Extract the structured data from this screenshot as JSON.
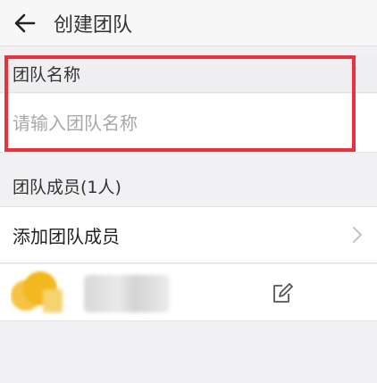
{
  "header": {
    "title": "创建团队",
    "back_icon": "arrow-left-icon"
  },
  "team_name": {
    "label": "团队名称",
    "placeholder": "请输入团队名称",
    "value": ""
  },
  "members": {
    "label": "团队成员(1人)",
    "add_label": "添加团队成员",
    "add_icon": "chevron-right-icon",
    "edit_icon": "edit-icon"
  },
  "colors": {
    "highlight": "#e8323c",
    "avatar": "#f3b81e"
  }
}
